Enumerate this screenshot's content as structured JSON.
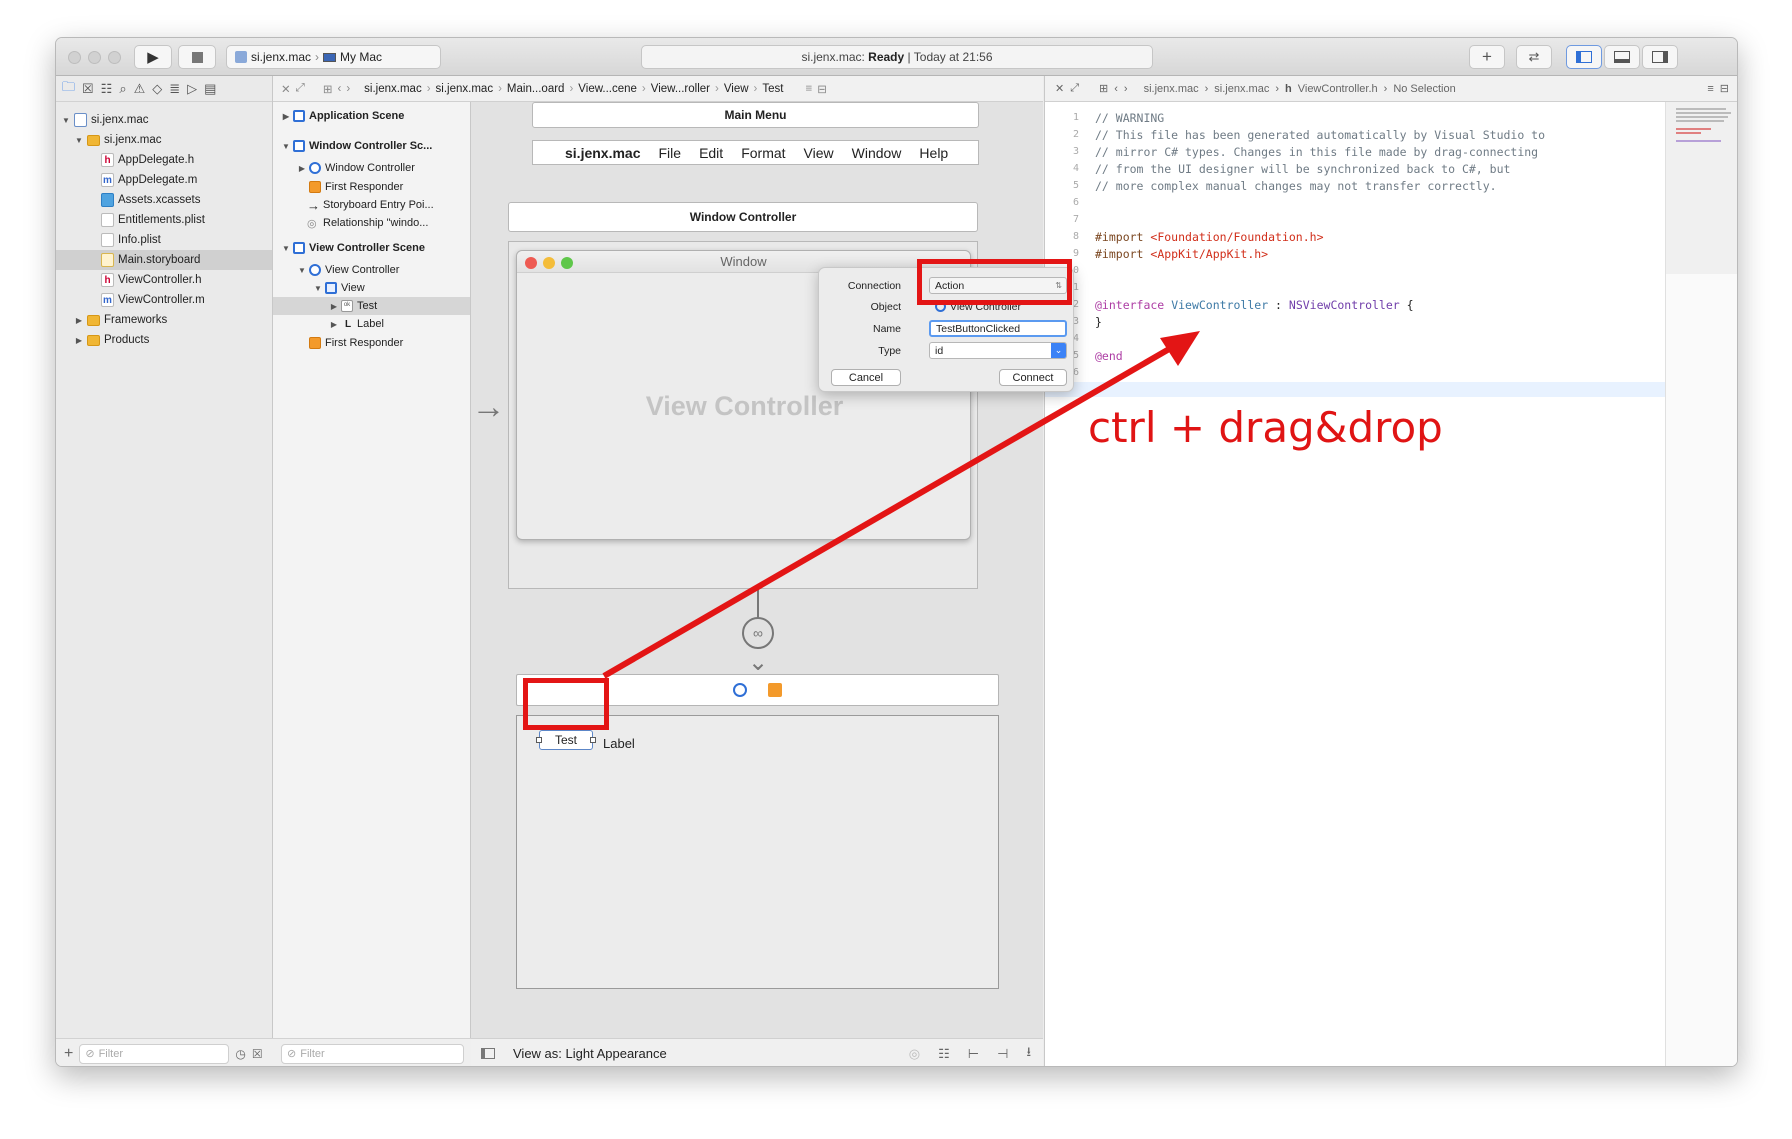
{
  "toolbar": {
    "scheme_project": "si.jenx.mac",
    "scheme_device": "My Mac",
    "activity_project": "si.jenx.mac:",
    "activity_status": "Ready",
    "activity_time": "| Today at 21:56"
  },
  "navigator": {
    "items": [
      {
        "label": "si.jenx.mac",
        "icon": "project-icon",
        "level": 0
      },
      {
        "label": "si.jenx.mac",
        "icon": "folder-icon",
        "level": 1
      },
      {
        "label": "AppDelegate.h",
        "icon": "header-file-icon",
        "level": 2
      },
      {
        "label": "AppDelegate.m",
        "icon": "source-file-icon",
        "level": 2
      },
      {
        "label": "Assets.xcassets",
        "icon": "asset-catalog-icon",
        "level": 2
      },
      {
        "label": "Entitlements.plist",
        "icon": "plist-icon",
        "level": 2
      },
      {
        "label": "Info.plist",
        "icon": "plist-icon",
        "level": 2
      },
      {
        "label": "Main.storyboard",
        "icon": "storyboard-icon",
        "level": 2,
        "selected": true
      },
      {
        "label": "ViewController.h",
        "icon": "header-file-icon",
        "level": 2
      },
      {
        "label": "ViewController.m",
        "icon": "source-file-icon",
        "level": 2
      },
      {
        "label": "Frameworks",
        "icon": "folder-icon",
        "level": 1
      },
      {
        "label": "Products",
        "icon": "folder-icon",
        "level": 1
      }
    ],
    "filter_placeholder": "Filter"
  },
  "outline": {
    "items": [
      {
        "label": "Application Scene",
        "bold": true
      },
      {
        "label": "Window Controller Sc...",
        "bold": true
      },
      {
        "label": "Window Controller"
      },
      {
        "label": "First Responder"
      },
      {
        "label": "Storyboard Entry Poi..."
      },
      {
        "label": "Relationship \"windo..."
      },
      {
        "label": "View Controller Scene",
        "bold": true
      },
      {
        "label": "View Controller"
      },
      {
        "label": "View"
      },
      {
        "label": "Test",
        "selected": true
      },
      {
        "label": "Label"
      },
      {
        "label": "First Responder"
      }
    ],
    "filter_placeholder": "Filter"
  },
  "ib_jumpbar": [
    "si.jenx.mac",
    "si.jenx.mac",
    "Main...oard",
    "View...cene",
    "View...roller",
    "View",
    "Test"
  ],
  "canvas": {
    "main_menu_title": "Main Menu",
    "menu_items": [
      "si.jenx.mac",
      "File",
      "Edit",
      "Format",
      "View",
      "Window",
      "Help"
    ],
    "window_controller_title": "Window Controller",
    "window_title": "Window",
    "view_controller_placeholder": "View Controller",
    "button_label": "Test",
    "label_text": "Label",
    "appearance": "View as: Light Appearance"
  },
  "popover": {
    "connection_label": "Connection",
    "connection_value": "Action",
    "object_label": "Object",
    "object_value": "View Controller",
    "name_label": "Name",
    "name_value": "TestButtonClicked",
    "type_label": "Type",
    "type_value": "id",
    "cancel": "Cancel",
    "connect": "Connect"
  },
  "editor": {
    "jump": [
      "si.jenx.mac",
      "si.jenx.mac",
      "ViewController.h",
      "No Selection"
    ],
    "line_numbers": [
      "1",
      "2",
      "3",
      "4",
      "5",
      "6",
      "7",
      "8",
      "9",
      "10",
      "11",
      "12",
      "13",
      "14",
      "15",
      "16"
    ],
    "comments": [
      "// WARNING",
      "// This file has been generated automatically by Visual Studio to",
      "// mirror C# types. Changes in this file made by drag-connecting",
      "// from the UI designer will be synchronized back to C#, but",
      "// more complex manual changes may not transfer correctly."
    ],
    "import1_kw": "#import",
    "import1_path": "<Foundation/Foundation.h>",
    "import2_kw": "#import",
    "import2_path": "<AppKit/AppKit.h>",
    "interface_kw": "@interface",
    "interface_name": "ViewController",
    "interface_sep": " : ",
    "interface_super": "NSViewController",
    "interface_brace": " {",
    "close_brace": "}",
    "end_kw": "@end"
  },
  "annotation": {
    "text": "ctrl + drag&drop",
    "color": "#e31515"
  }
}
